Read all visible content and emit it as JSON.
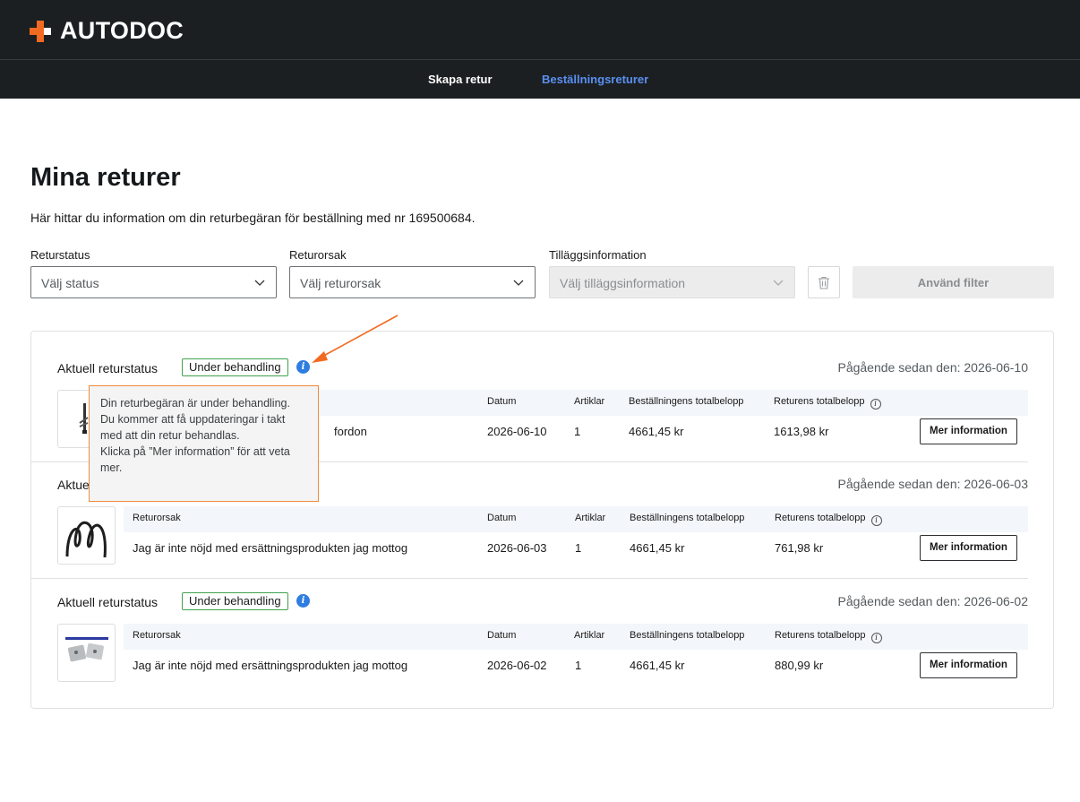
{
  "header": {
    "logo_text": "AUTODOC",
    "nav": [
      {
        "label": "Skapa retur"
      },
      {
        "label": "Beställningsreturer"
      }
    ]
  },
  "page": {
    "title": "Mina returer",
    "subtitle": "Här hittar du information om din returbegäran för beställning med nr 169500684."
  },
  "filters": {
    "status": {
      "label": "Returstatus",
      "placeholder": "Välj status"
    },
    "reason": {
      "label": "Returorsak",
      "placeholder": "Välj returorsak"
    },
    "extra": {
      "label": "Tilläggsinformation",
      "placeholder": "Välj tilläggsinformation"
    },
    "apply_label": "Använd filter"
  },
  "tooltip": {
    "line1": "Din returbegäran är under behandling. Du kommer att få uppdateringar i takt med att din retur behandlas.",
    "line2": "Klicka på ”Mer information” för att veta mer."
  },
  "table_headers": {
    "reason": "Returorsak",
    "date": "Datum",
    "items": "Artiklar",
    "order_total": "Beställningens totalbelopp",
    "return_total": "Returens totalbelopp"
  },
  "returns": [
    {
      "status_label": "Aktuell returstatus",
      "status": "Under behandling",
      "since": "Pågående sedan den: 2026-06-10",
      "reason_visible": "fordon",
      "date": "2026-06-10",
      "items": "1",
      "order_total": "4661,45 kr",
      "return_total": "1613,98 kr",
      "button": "Mer information"
    },
    {
      "status_label": "Aktue",
      "status": "",
      "since": "Pågående sedan den: 2026-06-03",
      "reason_visible": "Jag är inte nöjd med ersättningsprodukten jag mottog",
      "date": "2026-06-03",
      "items": "1",
      "order_total": "4661,45 kr",
      "return_total": "761,98 kr",
      "button": "Mer information"
    },
    {
      "status_label": "Aktuell returstatus",
      "status": "Under behandling",
      "since": "Pågående sedan den: 2026-06-02",
      "reason_visible": "Jag är inte nöjd med ersättningsprodukten jag mottog",
      "date": "2026-06-02",
      "items": "1",
      "order_total": "4661,45 kr",
      "return_total": "880,99 kr",
      "button": "Mer information"
    }
  ],
  "colors": {
    "header_bg": "#1b1f22",
    "brand_orange": "#f26a21",
    "nav_active": "#5a8ff0",
    "status_green": "#3fa34d",
    "info_blue": "#2f7de1",
    "table_head_bg": "#f3f6fa"
  }
}
